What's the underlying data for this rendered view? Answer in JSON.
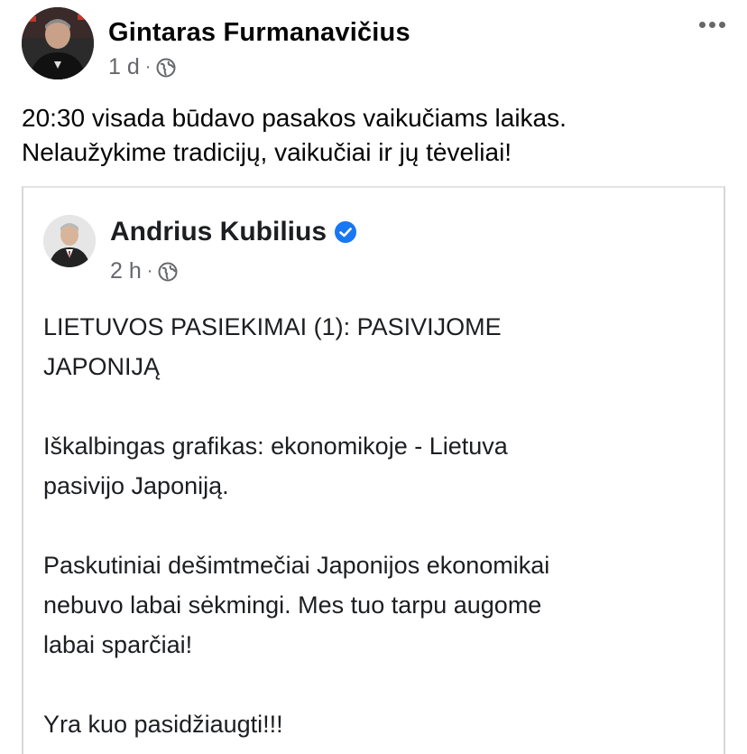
{
  "outer_post": {
    "author": "Gintaras Furmanavičius",
    "time": "1 d",
    "separator": "·",
    "audience_icon": "globe-icon",
    "more_icon": "more-options-icon",
    "text_lines": [
      "20:30 visada būdavo pasakos vaikučiams laikas.",
      "Nelaužykime tradicijų, vaikučiai ir jų tėveliai!"
    ]
  },
  "shared_post": {
    "author": "Andrius Kubilius",
    "verified_icon": "verified-badge-icon",
    "time": "2 h",
    "separator": "·",
    "audience_icon": "globe-icon",
    "paragraphs": [
      [
        "LIETUVOS PASIEKIMAI (1): PASIVIJOME",
        "JAPONIJĄ"
      ],
      [
        "Iškalbingas grafikas: ekonomikoje - Lietuva",
        "pasivijo Japoniją."
      ],
      [
        "Paskutiniai dešimtmečiai Japonijos ekonomikai",
        "nebuvo labai sėkmingi. Mes tuo tarpu augome",
        "labai sparčiai!"
      ],
      [
        "Yra kuo pasidžiaugti!!!"
      ]
    ]
  },
  "colors": {
    "text": "#050505",
    "meta": "#65676b",
    "verified": "#1877f2",
    "divider": "#d6d6d6"
  }
}
